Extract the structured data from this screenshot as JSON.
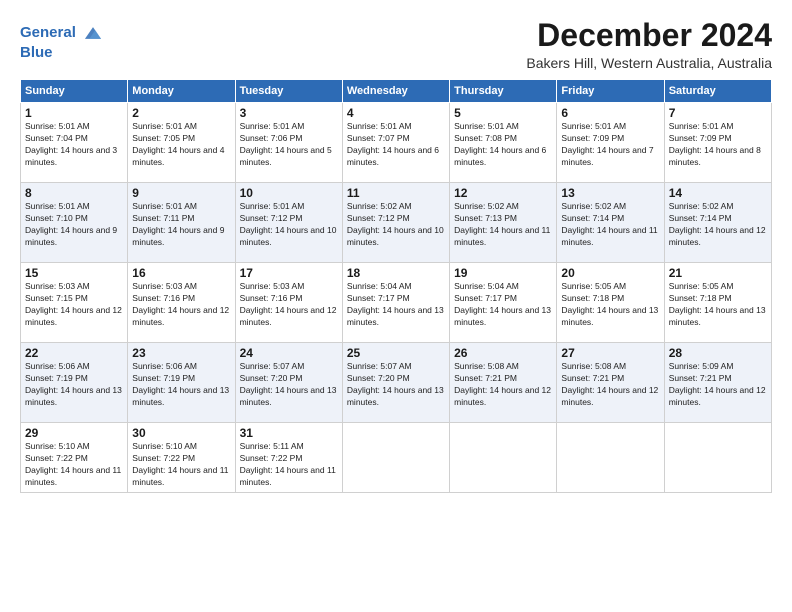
{
  "header": {
    "logo_line1": "General",
    "logo_line2": "Blue",
    "month_title": "December 2024",
    "location": "Bakers Hill, Western Australia, Australia"
  },
  "weekdays": [
    "Sunday",
    "Monday",
    "Tuesday",
    "Wednesday",
    "Thursday",
    "Friday",
    "Saturday"
  ],
  "weeks": [
    [
      {
        "day": "1",
        "sunrise": "5:01 AM",
        "sunset": "7:04 PM",
        "daylight": "14 hours and 3 minutes."
      },
      {
        "day": "2",
        "sunrise": "5:01 AM",
        "sunset": "7:05 PM",
        "daylight": "14 hours and 4 minutes."
      },
      {
        "day": "3",
        "sunrise": "5:01 AM",
        "sunset": "7:06 PM",
        "daylight": "14 hours and 5 minutes."
      },
      {
        "day": "4",
        "sunrise": "5:01 AM",
        "sunset": "7:07 PM",
        "daylight": "14 hours and 6 minutes."
      },
      {
        "day": "5",
        "sunrise": "5:01 AM",
        "sunset": "7:08 PM",
        "daylight": "14 hours and 6 minutes."
      },
      {
        "day": "6",
        "sunrise": "5:01 AM",
        "sunset": "7:09 PM",
        "daylight": "14 hours and 7 minutes."
      },
      {
        "day": "7",
        "sunrise": "5:01 AM",
        "sunset": "7:09 PM",
        "daylight": "14 hours and 8 minutes."
      }
    ],
    [
      {
        "day": "8",
        "sunrise": "5:01 AM",
        "sunset": "7:10 PM",
        "daylight": "14 hours and 9 minutes."
      },
      {
        "day": "9",
        "sunrise": "5:01 AM",
        "sunset": "7:11 PM",
        "daylight": "14 hours and 9 minutes."
      },
      {
        "day": "10",
        "sunrise": "5:01 AM",
        "sunset": "7:12 PM",
        "daylight": "14 hours and 10 minutes."
      },
      {
        "day": "11",
        "sunrise": "5:02 AM",
        "sunset": "7:12 PM",
        "daylight": "14 hours and 10 minutes."
      },
      {
        "day": "12",
        "sunrise": "5:02 AM",
        "sunset": "7:13 PM",
        "daylight": "14 hours and 11 minutes."
      },
      {
        "day": "13",
        "sunrise": "5:02 AM",
        "sunset": "7:14 PM",
        "daylight": "14 hours and 11 minutes."
      },
      {
        "day": "14",
        "sunrise": "5:02 AM",
        "sunset": "7:14 PM",
        "daylight": "14 hours and 12 minutes."
      }
    ],
    [
      {
        "day": "15",
        "sunrise": "5:03 AM",
        "sunset": "7:15 PM",
        "daylight": "14 hours and 12 minutes."
      },
      {
        "day": "16",
        "sunrise": "5:03 AM",
        "sunset": "7:16 PM",
        "daylight": "14 hours and 12 minutes."
      },
      {
        "day": "17",
        "sunrise": "5:03 AM",
        "sunset": "7:16 PM",
        "daylight": "14 hours and 12 minutes."
      },
      {
        "day": "18",
        "sunrise": "5:04 AM",
        "sunset": "7:17 PM",
        "daylight": "14 hours and 13 minutes."
      },
      {
        "day": "19",
        "sunrise": "5:04 AM",
        "sunset": "7:17 PM",
        "daylight": "14 hours and 13 minutes."
      },
      {
        "day": "20",
        "sunrise": "5:05 AM",
        "sunset": "7:18 PM",
        "daylight": "14 hours and 13 minutes."
      },
      {
        "day": "21",
        "sunrise": "5:05 AM",
        "sunset": "7:18 PM",
        "daylight": "14 hours and 13 minutes."
      }
    ],
    [
      {
        "day": "22",
        "sunrise": "5:06 AM",
        "sunset": "7:19 PM",
        "daylight": "14 hours and 13 minutes."
      },
      {
        "day": "23",
        "sunrise": "5:06 AM",
        "sunset": "7:19 PM",
        "daylight": "14 hours and 13 minutes."
      },
      {
        "day": "24",
        "sunrise": "5:07 AM",
        "sunset": "7:20 PM",
        "daylight": "14 hours and 13 minutes."
      },
      {
        "day": "25",
        "sunrise": "5:07 AM",
        "sunset": "7:20 PM",
        "daylight": "14 hours and 13 minutes."
      },
      {
        "day": "26",
        "sunrise": "5:08 AM",
        "sunset": "7:21 PM",
        "daylight": "14 hours and 12 minutes."
      },
      {
        "day": "27",
        "sunrise": "5:08 AM",
        "sunset": "7:21 PM",
        "daylight": "14 hours and 12 minutes."
      },
      {
        "day": "28",
        "sunrise": "5:09 AM",
        "sunset": "7:21 PM",
        "daylight": "14 hours and 12 minutes."
      }
    ],
    [
      {
        "day": "29",
        "sunrise": "5:10 AM",
        "sunset": "7:22 PM",
        "daylight": "14 hours and 11 minutes."
      },
      {
        "day": "30",
        "sunrise": "5:10 AM",
        "sunset": "7:22 PM",
        "daylight": "14 hours and 11 minutes."
      },
      {
        "day": "31",
        "sunrise": "5:11 AM",
        "sunset": "7:22 PM",
        "daylight": "14 hours and 11 minutes."
      },
      null,
      null,
      null,
      null
    ]
  ]
}
